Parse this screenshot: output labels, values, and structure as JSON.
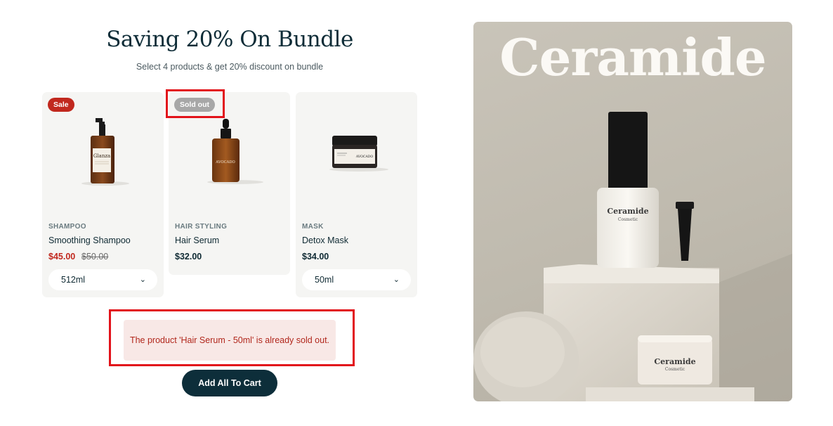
{
  "bundle": {
    "title": "Saving 20% On Bundle",
    "subtitle": "Select 4 products & get 20% discount on bundle",
    "add_all_label": "Add All To Cart",
    "alert": "The product 'Hair Serum - 50ml' is already sold out."
  },
  "products": [
    {
      "badge": "Sale",
      "category": "SHAMPOO",
      "name": "Smoothing Shampoo",
      "price": "$45.00",
      "compare_price": "$50.00",
      "variant": "512ml",
      "label_on_bottle": "Glanza"
    },
    {
      "badge": "Sold out",
      "category": "HAIR STYLING",
      "name": "Hair Serum",
      "price": "$32.00",
      "label_on_bottle": "AVOCADO"
    },
    {
      "category": "MASK",
      "name": "Detox Mask",
      "price": "$34.00",
      "variant": "50ml",
      "label_on_jar": "AVOCADO"
    }
  ],
  "hero": {
    "brand": "Ceramide",
    "bottle_label": "Ceramide",
    "bottle_sublabel": "Cosmetic",
    "jar_label": "Ceramide",
    "jar_sublabel": "Cosmetic"
  },
  "colors": {
    "primary": "#0d2e3a",
    "sale": "#c1281e",
    "soldout": "#a7a7a7",
    "alert_bg": "#f8e8e6",
    "highlight": "#e2131b"
  },
  "icons": {
    "variant_dropdown": "chevron-down-icon"
  }
}
